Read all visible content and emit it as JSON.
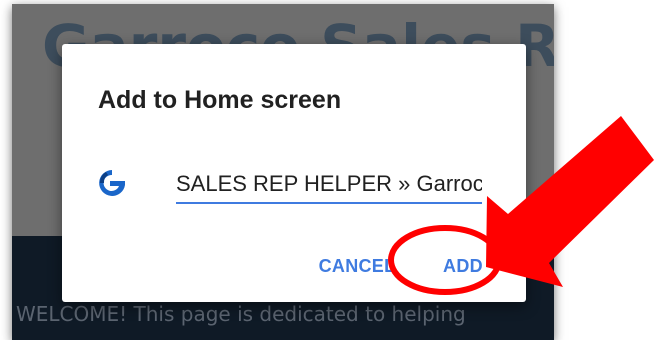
{
  "background_page": {
    "title": "Garroco Sales Rep",
    "welcome_text": "WELCOME! This page is dedicated to helping"
  },
  "dialog": {
    "title": "Add to Home screen",
    "app_icon": "garroco-logo-icon",
    "shortcut_name_value": "SALES REP HELPER » Garroco",
    "cancel_label": "CANCEL",
    "add_label": "ADD"
  },
  "annotation": {
    "arrow_icon": "red-arrow-icon",
    "circle_icon": "red-circle-icon"
  },
  "colors": {
    "accent": "#3f7be0",
    "annotation": "#ff0000",
    "page_body": "#0f1a26"
  }
}
